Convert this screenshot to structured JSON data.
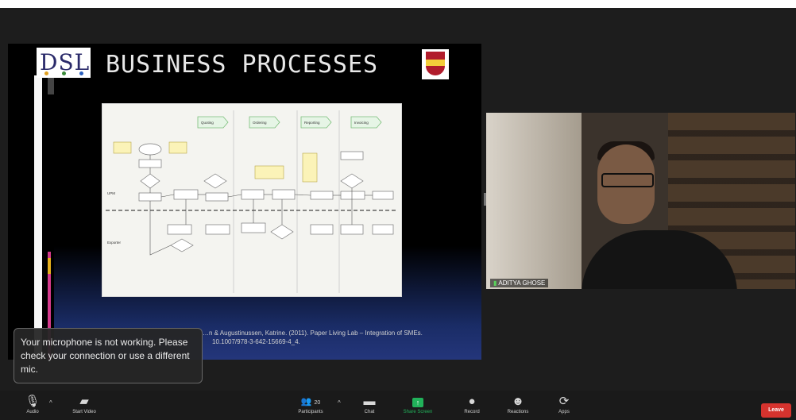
{
  "presentation": {
    "logo_text": "DSL",
    "title": "BUSINESS PROCESSES",
    "citation_line1": "…n & Augustinussen, Katrine. (2011). Paper Living Lab – Integration of SMEs.",
    "citation_line2": "10.1007/978-3-642-15669-4_4."
  },
  "diagram": {
    "lanes": [
      "Quoting",
      "Ordering",
      "Reporting",
      "Invoicing"
    ],
    "roles": [
      "UPM",
      "Exporter"
    ]
  },
  "video": {
    "participant_name": "ADITYA GHOSE"
  },
  "notification": {
    "highlight": "Your microphone is not working.",
    "message": "Please check your connection or use a different mic."
  },
  "toolbar": {
    "audio": "Audio",
    "start_video": "Start Video",
    "participants": "Participants",
    "participants_count": "20",
    "chat": "Chat",
    "share_screen": "Share Screen",
    "record": "Record",
    "reactions": "Reactions",
    "apps": "Apps",
    "leave": "Leave"
  },
  "colors": {
    "share_green": "#21b25a",
    "leave_red": "#d6332e",
    "slide_title": "#e8e8e8"
  }
}
